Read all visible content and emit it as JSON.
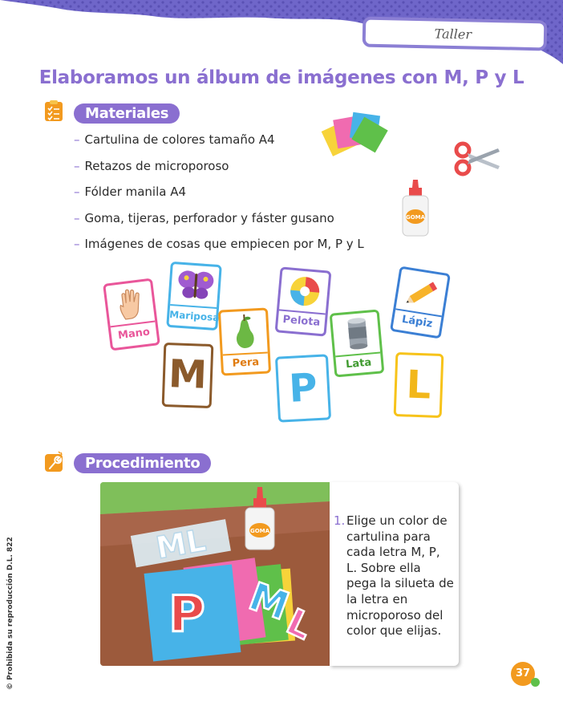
{
  "header": {
    "tab_label": "Taller"
  },
  "page_title": "Elaboramos un álbum de imágenes con M, P y L",
  "materials": {
    "heading": "Materiales",
    "items": [
      "Cartulina de colores tamaño A4",
      "Retazos de microporoso",
      "Fólder manila A4",
      "Goma, tijeras, perforador y fáster gusano",
      "Imágenes de cosas que empiecen por M, P y L"
    ],
    "glue_label": "GOMA"
  },
  "cards": {
    "mano": "Mano",
    "mariposa": "Mariposa",
    "pera": "Pera",
    "pelota": "Pelota",
    "lata": "Lata",
    "lapiz": "Lápiz",
    "letter_m": "M",
    "letter_p": "P",
    "letter_l": "L"
  },
  "procedure": {
    "heading": "Procedimiento",
    "steps": [
      {
        "number": "1.",
        "text": "Elige un color de cartulina para cada letra M, P, L. Sobre ella pega la silueta de la letra en microporoso del color que elijas."
      }
    ],
    "illustration": {
      "glue_label": "GOMA",
      "letter_p": "P",
      "letter_m": "M",
      "letter_l": "L",
      "cutout_text": "ML"
    }
  },
  "side_note": "© Prohibida su reproducción D.L. 822",
  "page_number": "37",
  "colors": {
    "accent": "#8a6fd0",
    "orange": "#f29a1f",
    "green": "#5fc04a"
  }
}
